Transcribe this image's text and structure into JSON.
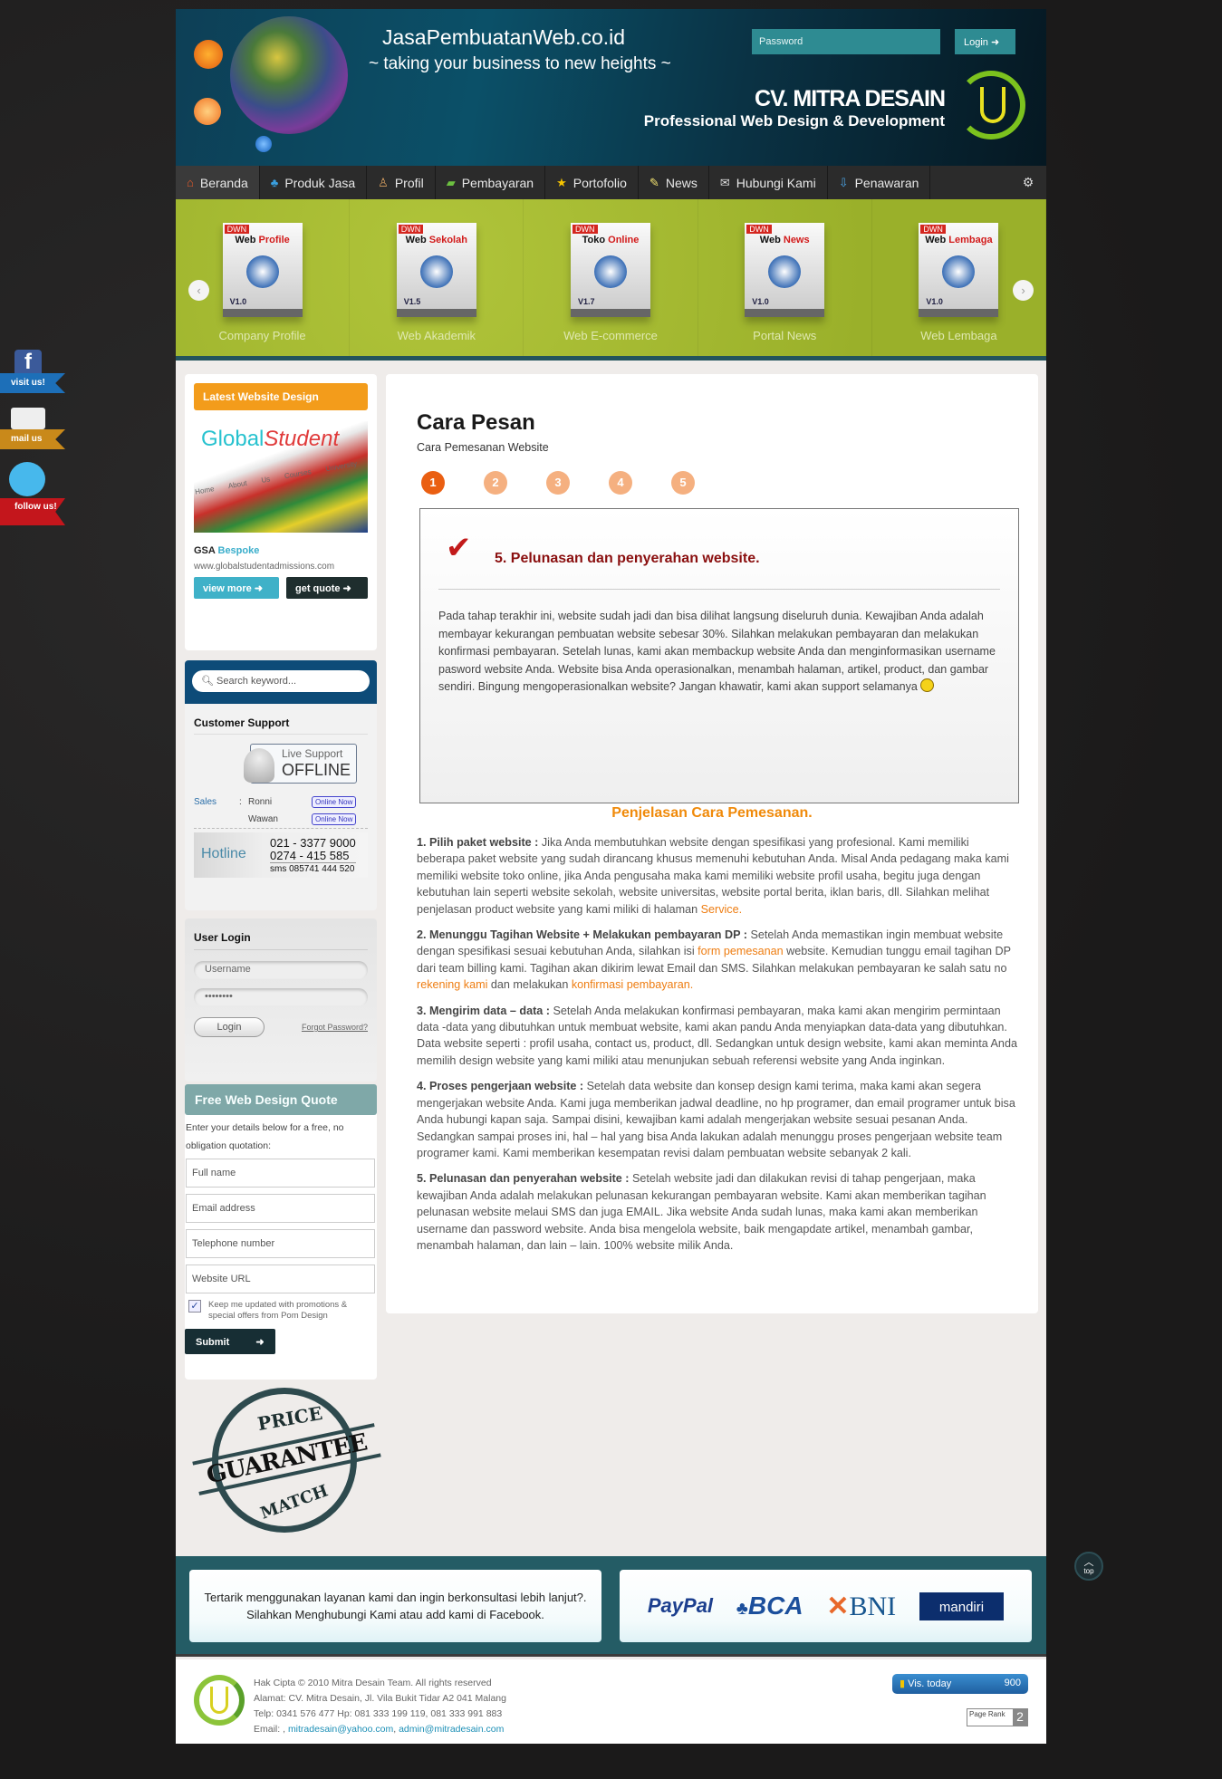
{
  "header": {
    "site_title": "JasaPembuatanWeb.co.id",
    "tagline": "~ taking your business to new heights ~",
    "company": "CV. MITRA DESAIN",
    "company_tagline": "Professional Web Design & Development",
    "password_placeholder": "Password",
    "login_label": "Login"
  },
  "nav": {
    "items": [
      {
        "label": "Beranda",
        "icon": "home-icon",
        "color": "#e65a2a",
        "glyph": "⌂"
      },
      {
        "label": "Produk Jasa",
        "icon": "shapes-icon",
        "color": "#3aa0e0",
        "glyph": "♣"
      },
      {
        "label": "Profil",
        "icon": "user-icon",
        "color": "#d8a060",
        "glyph": "♙"
      },
      {
        "label": "Pembayaran",
        "icon": "money-icon",
        "color": "#6cc040",
        "glyph": "▰"
      },
      {
        "label": "Portofolio",
        "icon": "star-icon",
        "color": "#f5c400",
        "glyph": "★"
      },
      {
        "label": "News",
        "icon": "note-icon",
        "color": "#f0e070",
        "glyph": "✎"
      },
      {
        "label": "Hubungi Kami",
        "icon": "mail-icon",
        "color": "#dddddd",
        "glyph": "✉"
      },
      {
        "label": "Penawaran",
        "icon": "download-icon",
        "color": "#4aa0e0",
        "glyph": "⇩"
      }
    ],
    "settings_icon": "gear-icon"
  },
  "slider": {
    "items": [
      {
        "brand": "DWN",
        "name1": "Web",
        "name2": "Profile",
        "version": "V1.0",
        "caption": "Company Profile"
      },
      {
        "brand": "DWN",
        "name1": "Web",
        "name2": "Sekolah",
        "version": "V1.5",
        "caption": "Web Akademik"
      },
      {
        "brand": "DWN",
        "name1": "Toko",
        "name2": "Online",
        "version": "V1.7",
        "caption": "Web E-commerce"
      },
      {
        "brand": "DWN",
        "name1": "Web",
        "name2": "News",
        "version": "V1.0",
        "caption": "Portal News"
      },
      {
        "brand": "DWN",
        "name1": "Web",
        "name2": "Lembaga",
        "version": "V1.0",
        "caption": "Web Lembaga"
      }
    ]
  },
  "social": {
    "facebook": "visit us!",
    "mail": "mail us",
    "twitter": "follow us!"
  },
  "sidebar": {
    "latest": {
      "title": "Latest Website Design",
      "image_logo1": "Global",
      "image_logo2": "Student",
      "image_tabs": [
        "Home",
        "About Us",
        "Courses",
        "University"
      ],
      "name_bold": "GSA",
      "name_accent": "Bespoke",
      "url": "www.globalstudentadmissions.com",
      "view_more": "view more",
      "get_quote": "get quote"
    },
    "search_placeholder": "Search keyword...",
    "support": {
      "title": "Customer Support",
      "live_label": "Live Support",
      "live_status": "OFFLINE",
      "dept": "Sales",
      "agents": [
        {
          "name": "Ronni",
          "status": "Online Now"
        },
        {
          "name": "Wawan",
          "status": "Online Now"
        }
      ],
      "hotline_label": "Hotline",
      "phone1": "021 - 3377 9000",
      "phone2": "0274  -  415 585",
      "sms": "sms 085741 444 520"
    },
    "user_login": {
      "title": "User Login",
      "username_placeholder": "Username",
      "password_value": "••••••••",
      "login": "Login",
      "forgot": "Forgot Password?"
    },
    "quote": {
      "title": "Free Web Design Quote",
      "intro": "Enter your details below for a free, no obligation quotation:",
      "fields": [
        "Full name",
        "Email address",
        "Telephone number",
        "Website URL"
      ],
      "checkbox_label": "Keep me updated with promotions & special offers from Pom Design",
      "checkbox_checked": true,
      "submit": "Submit"
    },
    "stamp": {
      "top": "PRICE",
      "middle": "GUARANTEE",
      "bottom": "MATCH"
    }
  },
  "main": {
    "title": "Cara Pesan",
    "subtitle": "Cara Pemesanan Website",
    "steps": [
      "1",
      "2",
      "3",
      "4",
      "5"
    ],
    "active_step": 1,
    "step_box": {
      "heading": "5. Pelunasan dan penyerahan website.",
      "body": "Pada tahap terakhir ini, website sudah jadi dan bisa dilihat langsung diseluruh dunia. Kewajiban Anda adalah membayar kekurangan pembuatan website sebesar 30%. Silahkan melakukan pembayaran dan melakukan konfirmasi pembayaran. Setelah lunas, kami akan membackup website Anda dan menginformasikan username pasword website Anda.  Website bisa Anda operasionalkan, menambah halaman, artikel, product, dan gambar sendiri. Bingung mengoperasionalkan website? Jangan khawatir, kami akan support selamanya"
    },
    "section_title": "Penjelasan Cara Pemesanan.",
    "paragraphs": [
      [
        {
          "t": "1. Pilih paket website :",
          "s": "b"
        },
        {
          "t": " Jika Anda membutuhkan website dengan spesifikasi  yang profesional. Kami memiliki beberapa paket website yang sudah dirancang khusus memenuhi kebutuhan  Anda. Misal Anda pedagang maka kami memiliki  website toko online, jika Anda pengusaha maka kami memiliki website profil usaha, begitu juga dengan kebutuhan lain seperti website sekolah, website universitas, website portal berita, iklan baris, dll. Silahkan melihat penjelasan product website yang kami miliki di halaman ",
          "s": ""
        },
        {
          "t": "Service",
          "s": "a"
        },
        {
          "t": ".",
          "s": "a"
        }
      ],
      [
        {
          "t": "2. Menunggu Tagihan Website + Melakukan pembayaran DP :",
          "s": "b"
        },
        {
          "t": "  Setelah Anda memastikan ingin membuat website dengan spesifikasi sesuai kebutuhan Anda, silahkan isi ",
          "s": ""
        },
        {
          "t": "form pemesanan",
          "s": "a"
        },
        {
          "t": " website. Kemudian tunggu email tagihan DP dari team billing kami. Tagihan akan dikirim lewat Email dan SMS. Silahkan melakukan pembayaran ke salah satu no ",
          "s": ""
        },
        {
          "t": "rekening kami",
          "s": "a"
        },
        {
          "t": " dan melakukan ",
          "s": ""
        },
        {
          "t": "konfirmasi pembayaran",
          "s": "a"
        },
        {
          "t": ".",
          "s": "a"
        }
      ],
      [
        {
          "t": "3. Mengirim data – data :",
          "s": "b"
        },
        {
          "t": " Setelah Anda melakukan konfirmasi pembayaran, maka kami akan mengirim permintaan data -data yang dibutuhkan untuk membuat website, kami akan pandu Anda menyiapkan data-data yang dibutuhkan. Data website seperti : profil usaha, contact us, product, dll. Sedangkan untuk design website, kami akan meminta Anda memilih design website yang kami miliki atau menunjukan sebuah referensi website yang Anda inginkan.",
          "s": ""
        }
      ],
      [
        {
          "t": "4. Proses pengerjaan website :",
          "s": "b"
        },
        {
          "t": " Setelah data website dan konsep design kami terima, maka kami akan segera mengerjakan website Anda. Kami juga memberikan jadwal deadline, no hp programer, dan email programer  untuk bisa Anda hubungi kapan saja. Sampai disini, kewajiban kami adalah mengerjakan website sesuai pesanan Anda.  Sedangkan sampai proses ini, hal – hal yang bisa Anda lakukan adalah menunggu proses pengerjaan website team programer kami. Kami memberikan kesempatan revisi dalam pembuatan website sebanyak 2 kali.",
          "s": ""
        }
      ],
      [
        {
          "t": "5. Pelunasan dan penyerahan website :",
          "s": "b"
        },
        {
          "t": " Setelah website jadi dan dilakukan revisi di tahap pengerjaan, maka kewajiban Anda adalah melakukan pelunasan kekurangan pembayaran website. Kami akan memberikan tagihan pelunasan website melaui SMS dan juga EMAIL. Jika website Anda sudah lunas, maka kami akan memberikan username dan password website. Anda bisa mengelola website, baik mengapdate artikel, menambah gambar, menambah halaman, dan lain – lain. 100% website milik Anda.",
          "s": ""
        }
      ]
    ]
  },
  "bottom": {
    "cta_line1": "Tertarik menggunakan layanan kami dan ingin berkonsultasi lebih lanjut?.",
    "cta_line2": "Silahkan Menghubungi Kami atau add kami di Facebook.",
    "payments": [
      "PayPal",
      "BCA",
      "BNI",
      "mandiri"
    ]
  },
  "footer": {
    "copyright": "Hak Cipta © 2010 Mitra Desain Team. All rights reserved",
    "address": "Alamat: CV. Mitra Desain, Jl. Vila Bukit Tidar A2 041 Malang",
    "phone": "Telp: 0341 576 477 Hp: 081 333 199 119, 081 333 991 883",
    "email_label": "Email: , ",
    "email1": "mitradesain@yahoo.com",
    "email2": "admin@mitradesain.com",
    "visitors_label": "Vis. today",
    "visitors_count": "900",
    "pagerank_label": "Page Rank",
    "pagerank_value": "2"
  },
  "top_button": "top",
  "colors": {
    "accent": "#ea5f12",
    "link": "#ee7d12",
    "teal": "#245c65",
    "nav_bg": "#2b2b2b",
    "slider_bg": "#a3b82e"
  }
}
